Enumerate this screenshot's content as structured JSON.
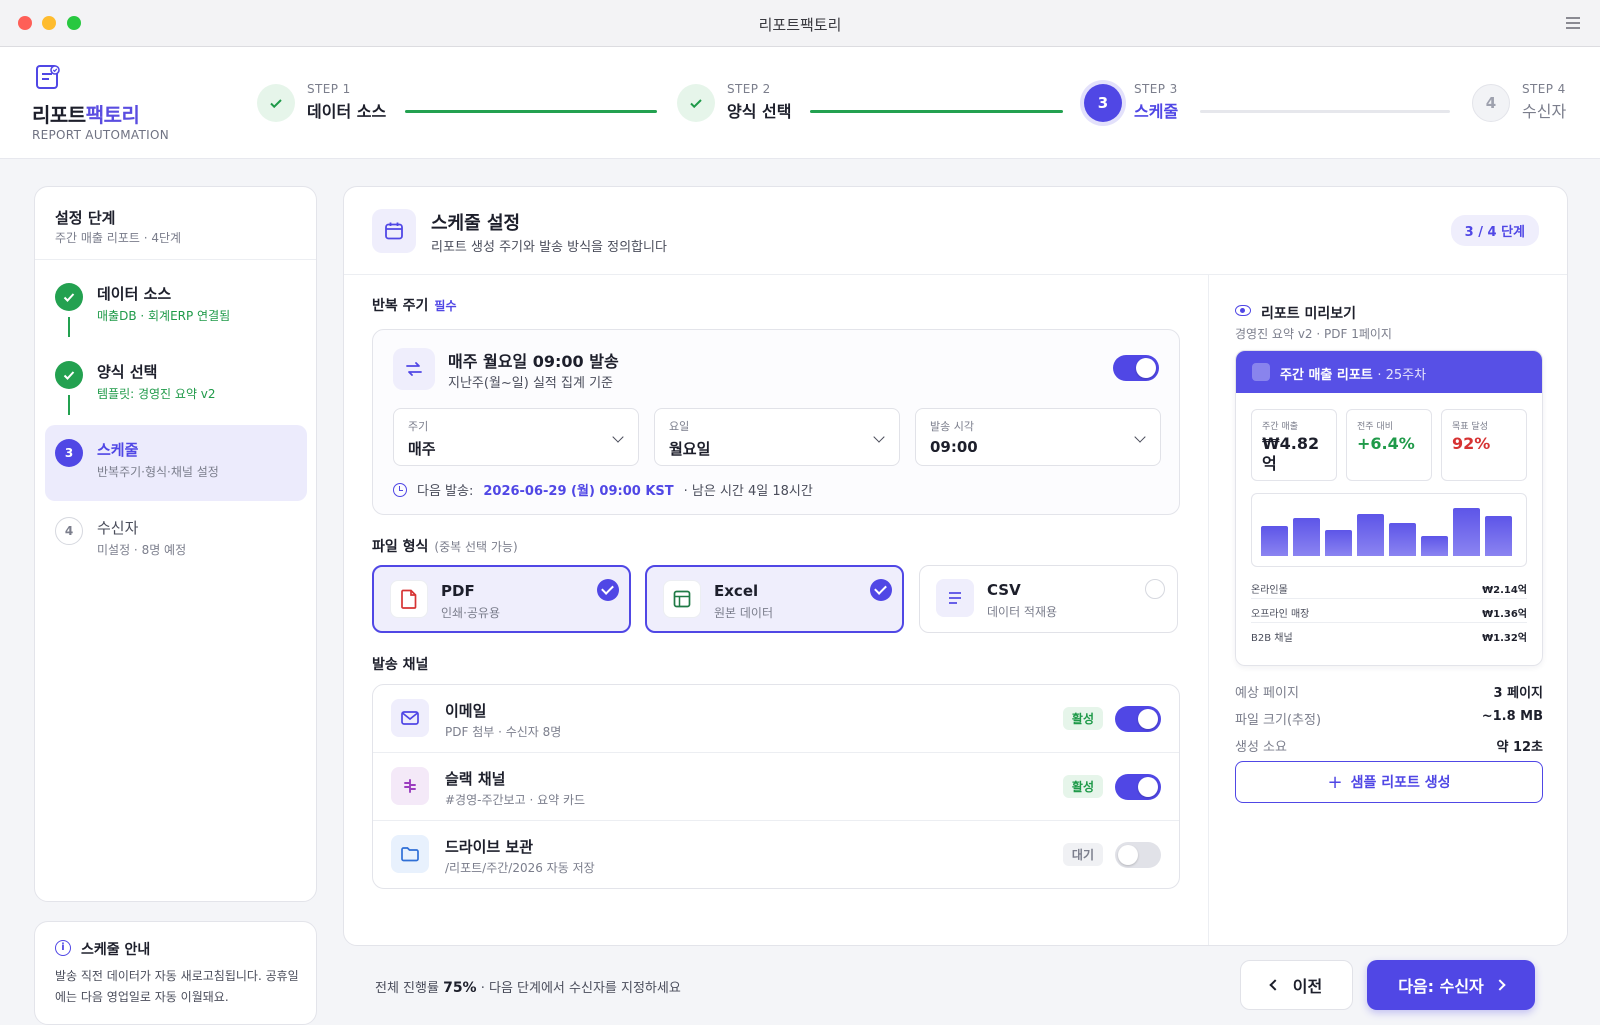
{
  "window": {
    "title": "리포트팩토리"
  },
  "brand": {
    "name_part1": "리포트",
    "name_part2": "팩토리",
    "subtitle": "REPORT AUTOMATION"
  },
  "stepper": [
    {
      "num": "STEP 1",
      "label": "데이터 소스",
      "state": "done"
    },
    {
      "num": "STEP 2",
      "label": "양식 선택",
      "state": "done"
    },
    {
      "num": "STEP 3",
      "label": "스케줄",
      "state": "active",
      "index": "3"
    },
    {
      "num": "STEP 4",
      "label": "수신자",
      "state": "todo",
      "index": "4"
    }
  ],
  "sidebar": {
    "title": "설정 단계",
    "subtitle": "주간 매출 리포트 · 4단계",
    "items": [
      {
        "label": "데이터 소스",
        "desc": "매출DB · 회계ERP 연결됨",
        "state": "done"
      },
      {
        "label": "양식 선택",
        "desc": "템플릿: 경영진 요약 v2",
        "state": "done"
      },
      {
        "label": "스케줄",
        "desc": "반복주기·형식·채널 설정",
        "state": "active",
        "index": "3"
      },
      {
        "label": "수신자",
        "desc": "미설정 · 8명 예정",
        "state": "todo",
        "index": "4"
      }
    ]
  },
  "info": {
    "title": "스케줄 안내",
    "text": "발송 직전 데이터가 자동 새로고침됩니다. 공휴일에는 다음 영업일로 자동 이월돼요."
  },
  "main": {
    "title": "스케줄 설정",
    "subtitle": "리포트 생성 주기와 발송 방식을 정의합니다",
    "step_badge": "3 / 4 단계",
    "repeat": {
      "label": "반복 주기",
      "required": "필수",
      "title": "매주 월요일 09:00 발송",
      "subtitle": "지난주(월~일) 실적 집계 기준",
      "enabled": true,
      "fields": [
        {
          "label": "주기",
          "value": "매주"
        },
        {
          "label": "요일",
          "value": "월요일"
        },
        {
          "label": "발송 시각",
          "value": "09:00"
        }
      ],
      "next_prefix": "다음 발송:",
      "next_date": "2026-06-29 (월) 09:00 KST",
      "remaining": "· 남은 시간 4일 18시간"
    },
    "format": {
      "label": "파일 형식",
      "hint": "(중복 선택 가능)",
      "options": [
        {
          "name": "PDF",
          "desc": "인쇄·공유용",
          "selected": true
        },
        {
          "name": "Excel",
          "desc": "원본 데이터",
          "selected": true
        },
        {
          "name": "CSV",
          "desc": "데이터 적재용",
          "selected": false
        }
      ]
    },
    "channels": {
      "label": "발송 채널",
      "items": [
        {
          "name": "이메일",
          "desc": "PDF 첨부 · 수신자 8명",
          "badge": "활성",
          "enabled": true
        },
        {
          "name": "슬랙 채널",
          "desc": "#경영-주간보고 · 요약 카드",
          "badge": "활성",
          "enabled": true
        },
        {
          "name": "드라이브 보관",
          "desc": "/리포트/주간/2026 자동 저장",
          "badge": "대기",
          "enabled": false
        }
      ]
    }
  },
  "preview": {
    "title": "리포트 미리보기",
    "subtitle": "경영진 요약 v2 · PDF 1페이지",
    "card_title": "주간 매출 리포트",
    "card_week": "· 25주차",
    "kpis": [
      {
        "label": "주간 매출",
        "value": "₩4.82억"
      },
      {
        "label": "전주 대비",
        "value": "+6.4%"
      },
      {
        "label": "목표 달성",
        "value": "92%"
      }
    ],
    "rows": [
      {
        "label": "온라인몰",
        "value": "₩2.14억"
      },
      {
        "label": "오프라인 매장",
        "value": "₩1.36억"
      },
      {
        "label": "B2B 채널",
        "value": "₩1.32억"
      }
    ],
    "stats": [
      {
        "label": "예상 페이지",
        "value": "3 페이지"
      },
      {
        "label": "파일 크기(추정)",
        "value": "~1.8 MB"
      },
      {
        "label": "생성 소요",
        "value": "약 12초"
      }
    ],
    "sample_button": "샘플 리포트 생성"
  },
  "footer": {
    "progress_prefix": "전체 진행률",
    "progress_value": "75%",
    "progress_suffix": "· 다음 단계에서 수신자를 지정하세요",
    "prev_label": "이전",
    "next_label": "다음: 수신자"
  },
  "colors": {
    "accent": "#5047e5",
    "success": "#23a150",
    "danger": "#d63333"
  }
}
